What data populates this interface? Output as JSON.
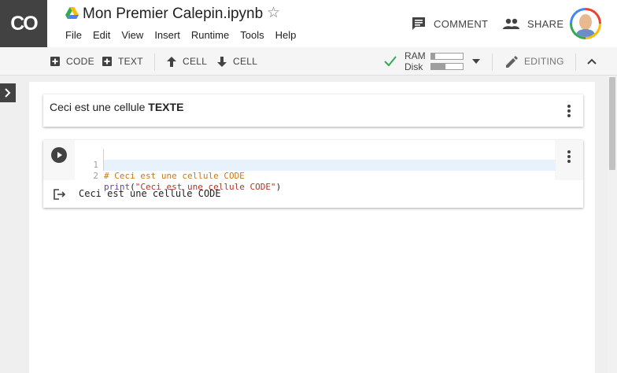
{
  "app": {
    "logo_text": "CO"
  },
  "header": {
    "title": "Mon Premier Calepin.ipynb",
    "menu": [
      "File",
      "Edit",
      "View",
      "Insert",
      "Runtime",
      "Tools",
      "Help"
    ],
    "comment_label": "COMMENT",
    "share_label": "SHARE"
  },
  "toolbar": {
    "add_code_label": "CODE",
    "add_text_label": "TEXT",
    "cell_up_label": "CELL",
    "cell_down_label": "CELL",
    "ram_label": "RAM",
    "disk_label": "Disk",
    "ram_usage": 0.12,
    "disk_usage": 0.45,
    "editing_label": "EDITING",
    "status_color": "#34a853"
  },
  "cells": {
    "text_cell": {
      "text_plain": "Ceci est une cellule ",
      "text_bold": "TEXTE"
    },
    "code_cell": {
      "line_numbers": [
        "1",
        "2"
      ],
      "line1_comment": "# Ceci est une cellule CODE",
      "line2_keyword": "print",
      "line2_open": "(",
      "line2_string": "\"Ceci est une cellule CODE\"",
      "line2_close": ")",
      "output": "Ceci est une cellule CODE"
    }
  },
  "icons": {
    "drive": "google-drive-icon",
    "star": "star-outline-icon",
    "comment": "comment-icon",
    "share": "people-icon",
    "run": "play-icon",
    "output": "output-arrow-icon",
    "more": "more-vert-icon"
  }
}
